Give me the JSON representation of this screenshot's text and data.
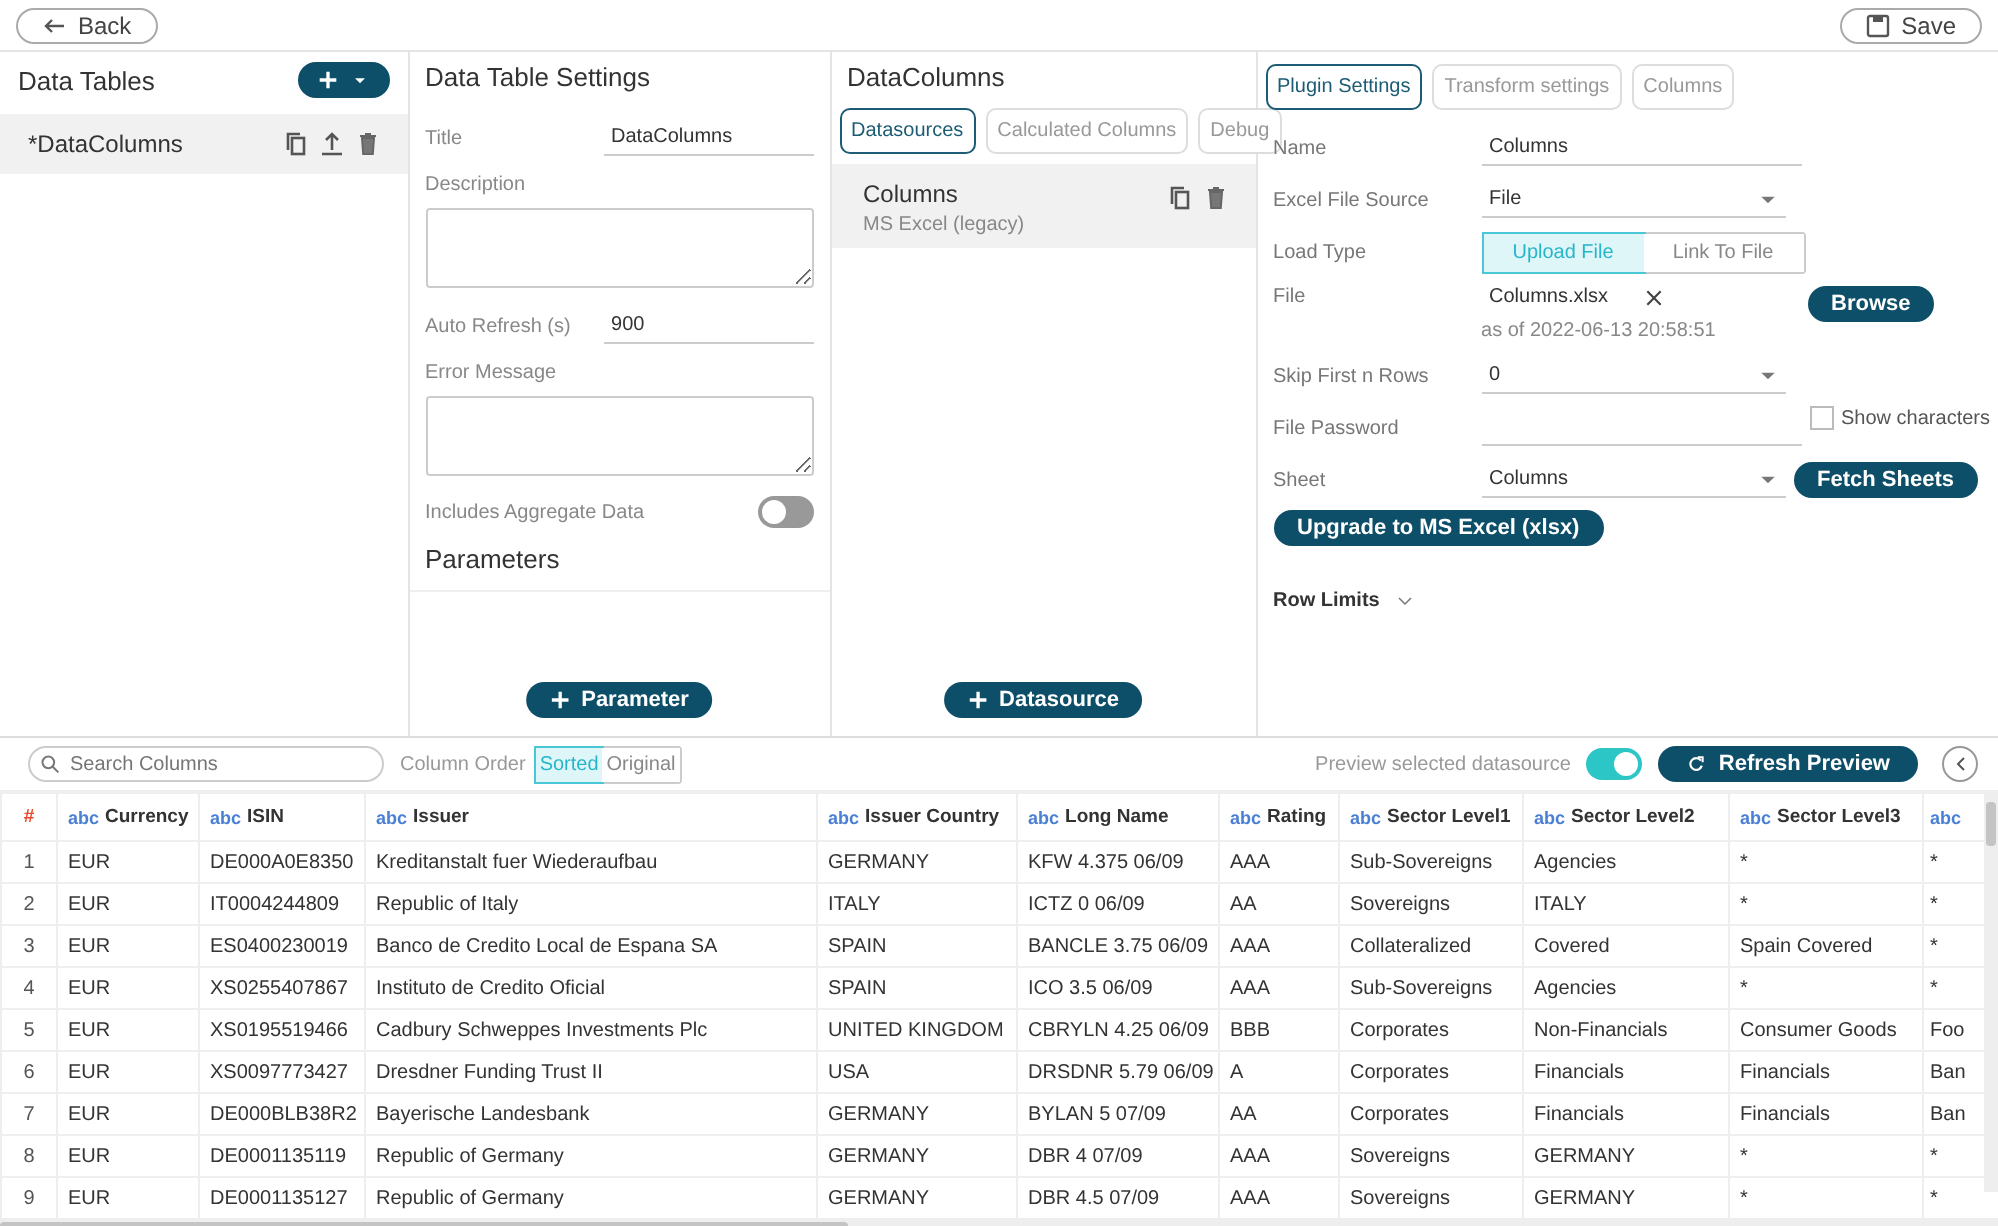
{
  "top_bar": {
    "back": "Back",
    "save": "Save"
  },
  "data_tables": {
    "title": "Data Tables",
    "items": [
      {
        "name": "*DataColumns",
        "selected": true
      }
    ]
  },
  "settings": {
    "title": "Data Table Settings",
    "fields": [
      {
        "kind": "input",
        "label": "Title",
        "value": "DataColumns"
      },
      {
        "kind": "textarea",
        "label": "Description"
      },
      {
        "kind": "input",
        "label": "Auto Refresh (s)",
        "value": "900"
      },
      {
        "kind": "textarea",
        "label": "Error Message"
      },
      {
        "kind": "toggle",
        "label": "Includes Aggregate Data",
        "on": false
      }
    ],
    "parameters_title": "Parameters",
    "add_parameter": "Parameter"
  },
  "datacolumns": {
    "title": "DataColumns",
    "tabs": [
      {
        "label": "Datasources",
        "selected": true
      },
      {
        "label": "Calculated Columns",
        "selected": false
      },
      {
        "label": "Debug",
        "selected": false
      }
    ],
    "items": [
      {
        "name": "Columns",
        "type": "MS Excel (legacy)",
        "selected": true
      }
    ],
    "add_datasource": "Datasource"
  },
  "plugin": {
    "tabs": [
      {
        "label": "Plugin Settings",
        "selected": true
      },
      {
        "label": "Transform settings",
        "selected": false
      },
      {
        "label": "Columns",
        "selected": false
      }
    ],
    "name_label": "Name",
    "name_value": "Columns",
    "source_label": "Excel File Source",
    "source_value": "File",
    "load_label": "Load Type",
    "load_options": [
      {
        "label": "Upload File",
        "selected": true
      },
      {
        "label": "Link To File",
        "selected": false
      }
    ],
    "file_label": "File",
    "file_name": "Columns.xlsx",
    "file_date": "as of 2022-06-13 20:58:51",
    "browse": "Browse",
    "skip_label": "Skip First n Rows",
    "skip_value": "0",
    "password_label": "File Password",
    "show_characters": {
      "label": "Show characters",
      "checked": false
    },
    "sheet_label": "Sheet",
    "sheet_value": "Columns",
    "fetch": "Fetch Sheets",
    "upgrade": "Upgrade to MS Excel (xlsx)",
    "row_limits": "Row Limits"
  },
  "preview_toolbar": {
    "search_placeholder": "Search Columns",
    "order_label": "Column Order",
    "order_options": [
      {
        "label": "Sorted",
        "selected": true
      },
      {
        "label": "Original",
        "selected": false
      }
    ],
    "preview_label": "Preview selected datasource",
    "preview_on": true,
    "refresh": "Refresh Preview"
  },
  "table": {
    "index_header": "#",
    "columns": [
      {
        "type": "abc",
        "name": "Currency"
      },
      {
        "type": "abc",
        "name": "ISIN"
      },
      {
        "type": "abc",
        "name": "Issuer"
      },
      {
        "type": "abc",
        "name": "Issuer Country"
      },
      {
        "type": "abc",
        "name": "Long Name"
      },
      {
        "type": "abc",
        "name": "Rating"
      },
      {
        "type": "abc",
        "name": "Sector Level1"
      },
      {
        "type": "abc",
        "name": "Sector Level2"
      },
      {
        "type": "abc",
        "name": "Sector Level3"
      },
      {
        "type": "abc"
      }
    ],
    "rows": [
      {
        "index": "1",
        "cells": [
          "EUR",
          "DE000A0E8350",
          "Kreditanstalt fuer Wiederaufbau",
          "GERMANY",
          "KFW 4.375 06/09",
          "AAA",
          "Sub-Sovereigns",
          "Agencies",
          "*",
          "*"
        ]
      },
      {
        "index": "2",
        "cells": [
          "EUR",
          "IT0004244809",
          "Republic of Italy",
          "ITALY",
          "ICTZ 0 06/09",
          "AA",
          "Sovereigns",
          "ITALY",
          "*",
          "*"
        ]
      },
      {
        "index": "3",
        "cells": [
          "EUR",
          "ES0400230019",
          "Banco de Credito Local de Espana SA",
          "SPAIN",
          "BANCLE 3.75 06/09",
          "AAA",
          "Collateralized",
          "Covered",
          "Spain Covered",
          "*"
        ]
      },
      {
        "index": "4",
        "cells": [
          "EUR",
          "XS0255407867",
          "Instituto de Credito Oficial",
          "SPAIN",
          "ICO 3.5 06/09",
          "AAA",
          "Sub-Sovereigns",
          "Agencies",
          "*",
          "*"
        ]
      },
      {
        "index": "5",
        "cells": [
          "EUR",
          "XS0195519466",
          "Cadbury Schweppes Investments Plc",
          "UNITED KINGDOM",
          "CBRYLN 4.25 06/09",
          "BBB",
          "Corporates",
          "Non-Financials",
          "Consumer Goods",
          "Foo"
        ]
      },
      {
        "index": "6",
        "cells": [
          "EUR",
          "XS0097773427",
          "Dresdner Funding Trust II",
          "USA",
          "DRSDNR 5.79 06/09",
          "A",
          "Corporates",
          "Financials",
          "Financials",
          "Ban"
        ]
      },
      {
        "index": "7",
        "cells": [
          "EUR",
          "DE000BLB38R2",
          "Bayerische Landesbank",
          "GERMANY",
          "BYLAN 5 07/09",
          "AA",
          "Corporates",
          "Financials",
          "Financials",
          "Ban"
        ]
      },
      {
        "index": "8",
        "cells": [
          "EUR",
          "DE0001135119",
          "Republic of Germany",
          "GERMANY",
          "DBR 4 07/09",
          "AAA",
          "Sovereigns",
          "GERMANY",
          "*",
          "*"
        ]
      },
      {
        "index": "9",
        "cells": [
          "EUR",
          "DE0001135127",
          "Republic of Germany",
          "GERMANY",
          "DBR 4.5 07/09",
          "AAA",
          "Sovereigns",
          "GERMANY",
          "*",
          "*"
        ]
      }
    ]
  }
}
